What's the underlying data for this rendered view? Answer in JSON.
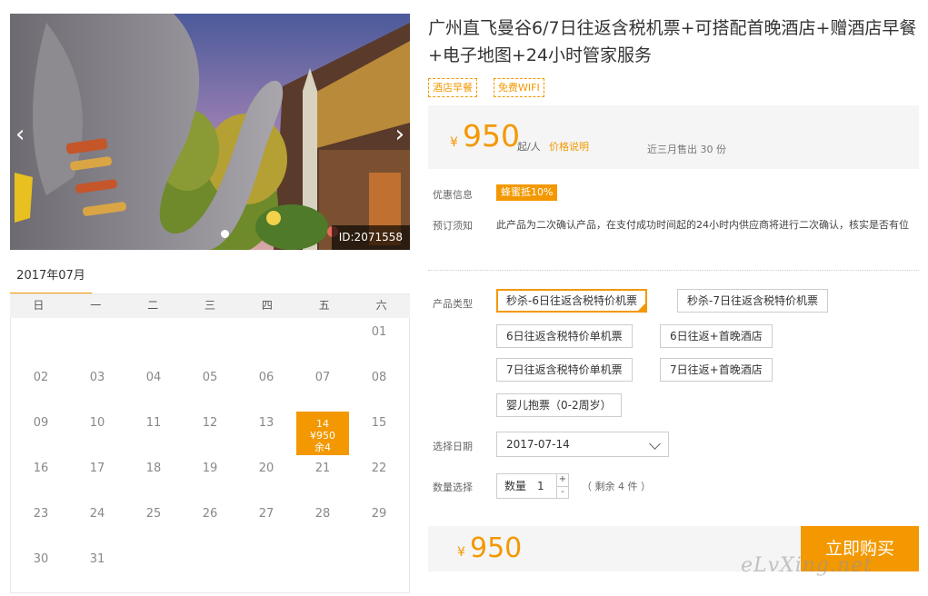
{
  "gallery": {
    "photo_id": "ID:2071558",
    "prev_icon": "‹",
    "next_icon": "›"
  },
  "calendar": {
    "month_label": "2017年07月",
    "weekdays": [
      "日",
      "一",
      "二",
      "三",
      "四",
      "五",
      "六"
    ],
    "weeks": [
      [
        "",
        "",
        "",
        "",
        "",
        "",
        "01"
      ],
      [
        "02",
        "03",
        "04",
        "05",
        "06",
        "07",
        "08"
      ],
      [
        "09",
        "10",
        "11",
        "12",
        "13",
        "14",
        "15"
      ],
      [
        "16",
        "17",
        "18",
        "19",
        "20",
        "21",
        "22"
      ],
      [
        "23",
        "24",
        "25",
        "26",
        "27",
        "28",
        "29"
      ],
      [
        "30",
        "31",
        "",
        "",
        "",
        "",
        ""
      ]
    ],
    "selected": {
      "day": "14",
      "price": "¥950",
      "stock": "余4"
    }
  },
  "product": {
    "title": "广州直飞曼谷6/7日往返含税机票+可搭配首晚酒店+赠酒店早餐+电子地图+24小时管家服务",
    "tags": [
      "酒店早餐",
      "免费WIFI"
    ]
  },
  "price_box": {
    "currency": "¥",
    "price": "950",
    "unit": "起/人",
    "explain_link": "价格说明",
    "sold": "近三月售出 30 份"
  },
  "promo": {
    "label": "优惠信息",
    "badge": "蜂蜜抵10%"
  },
  "notice": {
    "label": "预订须知",
    "text": "此产品为二次确认产品，在支付成功时间起的24小时内供应商将进行二次确认，核实是否有位"
  },
  "product_type": {
    "label": "产品类型",
    "options": [
      "秒杀-6日往返含税特价机票",
      "秒杀-7日往返含税特价机票",
      "6日往返含税特价单机票",
      "6日往返+首晚酒店",
      "7日往返含税特价单机票",
      "7日往返+首晚酒店",
      "婴儿抱票（0-2周岁）"
    ],
    "selected_index": 0
  },
  "date": {
    "label": "选择日期",
    "value": "2017-07-14"
  },
  "quantity": {
    "label": "数量选择",
    "inner_label": "数量",
    "value": "1",
    "plus": "+",
    "minus": "-",
    "remain": "（ 剩余 4 件 ）"
  },
  "bottom": {
    "currency": "¥",
    "price": "950",
    "buy_label": "立即购买"
  },
  "watermark": "eLvXing.net",
  "colors": {
    "accent": "#f39800"
  }
}
